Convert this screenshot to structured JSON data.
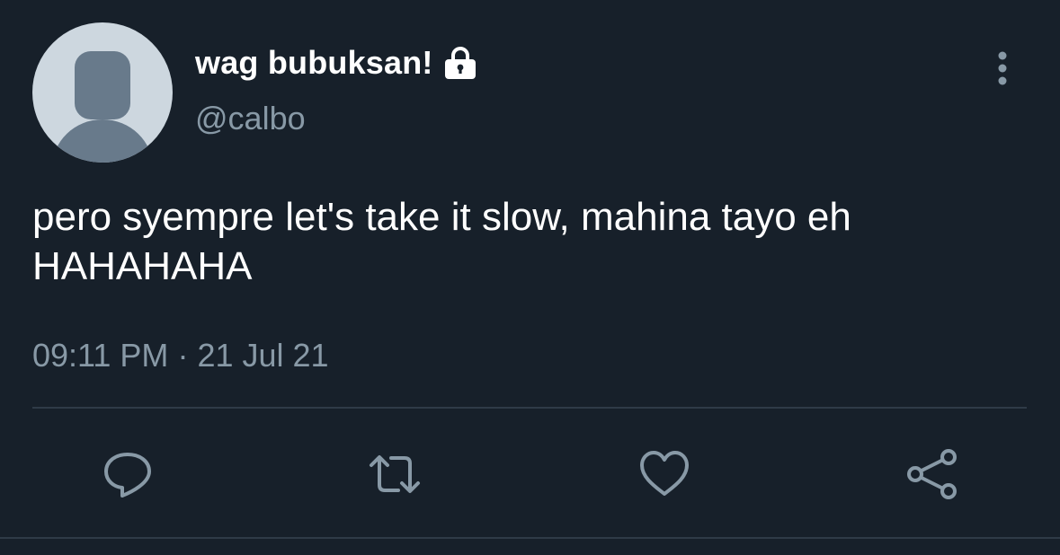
{
  "tweet": {
    "display_name": "wag bubuksan!",
    "handle": "@calbo",
    "text": "pero syempre let's take it slow, mahina tayo eh HAHAHAHA",
    "time": "09:11 PM",
    "separator": "·",
    "date": "21 Jul 21",
    "protected_icon": "lock-icon",
    "menu_icon": "vertical-ellipsis-icon"
  },
  "actions": [
    {
      "name": "reply",
      "icon": "speech-bubble-icon"
    },
    {
      "name": "retweet",
      "icon": "retweet-arrows-icon"
    },
    {
      "name": "like",
      "icon": "heart-icon"
    },
    {
      "name": "share",
      "icon": "share-nodes-icon"
    }
  ],
  "colors": {
    "background": "#17202a",
    "primary_text": "#ffffff",
    "secondary_text": "#8899a6",
    "divider": "#2f3b47",
    "avatar_bg": "#cdd7df",
    "avatar_figure": "#687a8b"
  }
}
